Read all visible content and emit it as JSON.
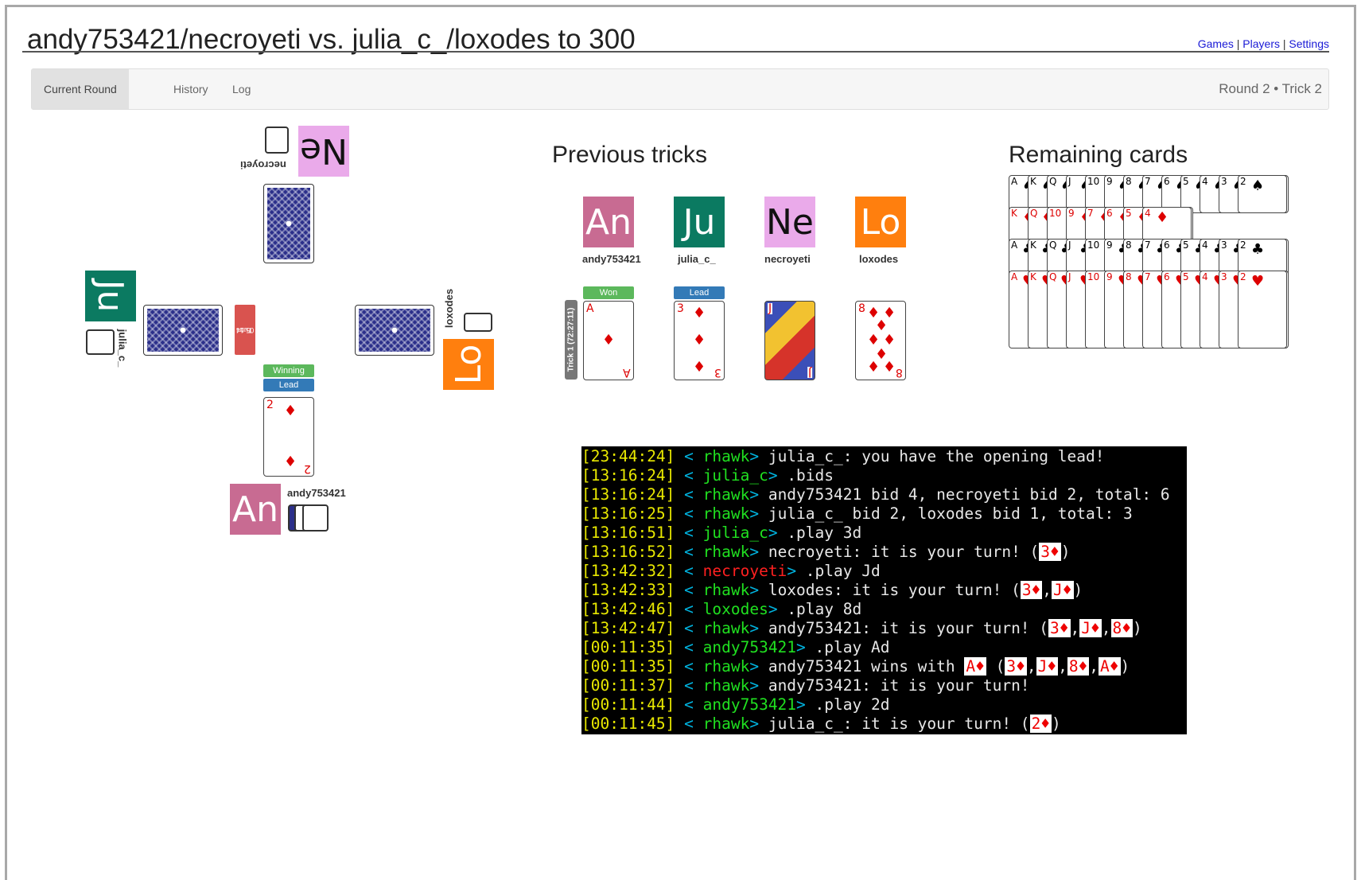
{
  "title": "andy753421/necroyeti vs. julia_c_/loxodes to 300",
  "toplinks": {
    "games": "Games",
    "players": "Players",
    "settings": "Settings",
    "sep": "|"
  },
  "nav": {
    "tabs": [
      "Current Round",
      "History",
      "Log"
    ],
    "active_tab": "Current Round",
    "round_info": "Round 2 • Trick 2"
  },
  "table": {
    "players": {
      "north": {
        "name": "necroyeti",
        "avatar": "Ne",
        "color": "#eaaaea"
      },
      "west": {
        "name": "julia_c_",
        "avatar": "Ju",
        "color": "#0b7a61"
      },
      "east": {
        "name": "loxodes",
        "avatar": "Lo",
        "color": "#ff7f0e"
      },
      "south": {
        "name": "andy753421",
        "avatar": "An",
        "color": "#c86b92"
      }
    },
    "turn_label": "Turn",
    "turn_time": "05:14",
    "winning_label": "Winning",
    "lead_label": "Lead",
    "south_card": {
      "rank": "2",
      "suit": "♦"
    }
  },
  "previous_tricks": {
    "title": "Previous tricks",
    "trick_label": "Trick 1 (72:27:11)",
    "won_label": "Won",
    "lead_label": "Lead",
    "players": [
      {
        "name": "andy753421",
        "avatar": "An",
        "color": "#c86b92",
        "card_rank": "A",
        "card_suit": "♦"
      },
      {
        "name": "julia_c_",
        "avatar": "Ju",
        "color": "#0b7a61",
        "card_rank": "3",
        "card_suit": "♦"
      },
      {
        "name": "necroyeti",
        "avatar": "Ne",
        "color": "#eaaaea",
        "card_rank": "J",
        "card_suit": "♦"
      },
      {
        "name": "loxodes",
        "avatar": "Lo",
        "color": "#ff7f0e",
        "card_rank": "8",
        "card_suit": "♦"
      }
    ]
  },
  "remaining": {
    "title": "Remaining cards",
    "rows": [
      {
        "suit": "♠",
        "color": "#000000",
        "ranks": [
          "A",
          "K",
          "Q",
          "J",
          "10",
          "9",
          "8",
          "7",
          "6",
          "5",
          "4",
          "3",
          "2"
        ]
      },
      {
        "suit": "♦",
        "color": "#dd0000",
        "ranks": [
          "K",
          "Q",
          "10",
          "9",
          "7",
          "6",
          "5",
          "4"
        ]
      },
      {
        "suit": "♣",
        "color": "#000000",
        "ranks": [
          "A",
          "K",
          "Q",
          "J",
          "10",
          "9",
          "8",
          "7",
          "6",
          "5",
          "4",
          "3",
          "2"
        ]
      },
      {
        "suit": "♥",
        "color": "#dd0000",
        "ranks": [
          "A",
          "K",
          "Q",
          "J",
          "10",
          "9",
          "8",
          "7",
          "6",
          "5",
          "4",
          "3",
          "2"
        ]
      }
    ]
  },
  "log": [
    {
      "time": "23:44:24",
      "nick": "rhawk",
      "nick_color": "green",
      "msg": "julia_c_: you have the opening lead!",
      "cards": []
    },
    {
      "time": "13:16:24",
      "nick": "julia_c",
      "nick_color": "green",
      "msg": ".bids",
      "cards": []
    },
    {
      "time": "13:16:24",
      "nick": "rhawk",
      "nick_color": "green",
      "msg": "andy753421 bid 4, necroyeti bid 2, total: 6",
      "cards": []
    },
    {
      "time": "13:16:25",
      "nick": "rhawk",
      "nick_color": "green",
      "msg": "julia_c_ bid 2, loxodes bid 1, total: 3",
      "cards": []
    },
    {
      "time": "13:16:51",
      "nick": "julia_c",
      "nick_color": "green",
      "msg": ".play 3d",
      "cards": []
    },
    {
      "time": "13:16:52",
      "nick": "rhawk",
      "nick_color": "green",
      "msg": "necroyeti: it is your turn! (",
      "cards": [
        "3♦"
      ],
      "tail": ")"
    },
    {
      "time": "13:42:32",
      "nick": "necroyeti",
      "nick_color": "red",
      "msg": ".play Jd",
      "cards": []
    },
    {
      "time": "13:42:33",
      "nick": "rhawk",
      "nick_color": "green",
      "msg": "loxodes: it is your turn! (",
      "cards": [
        "3♦",
        "J♦"
      ],
      "tail": ")"
    },
    {
      "time": "13:42:46",
      "nick": "loxodes",
      "nick_color": "green",
      "msg": ".play 8d",
      "cards": []
    },
    {
      "time": "13:42:47",
      "nick": "rhawk",
      "nick_color": "green",
      "msg": "andy753421: it is your turn! (",
      "cards": [
        "3♦",
        "J♦",
        "8♦"
      ],
      "tail": ")"
    },
    {
      "time": "00:11:35",
      "nick": "andy753421",
      "nick_color": "green",
      "msg": ".play Ad",
      "cards": []
    },
    {
      "time": "00:11:35",
      "nick": "rhawk",
      "nick_color": "green",
      "msg": "andy753421 wins with ",
      "cards": [
        "A♦"
      ],
      "mid": " (",
      "cards2": [
        "3♦",
        "J♦",
        "8♦",
        "A♦"
      ],
      "tail": ")"
    },
    {
      "time": "00:11:37",
      "nick": "rhawk",
      "nick_color": "green",
      "msg": "andy753421: it is your turn!",
      "cards": []
    },
    {
      "time": "00:11:44",
      "nick": "andy753421",
      "nick_color": "green",
      "msg": ".play 2d",
      "cards": []
    },
    {
      "time": "00:11:45",
      "nick": "rhawk",
      "nick_color": "green",
      "msg": "julia_c_: it is your turn! (",
      "cards": [
        "2♦"
      ],
      "tail": ")"
    }
  ]
}
